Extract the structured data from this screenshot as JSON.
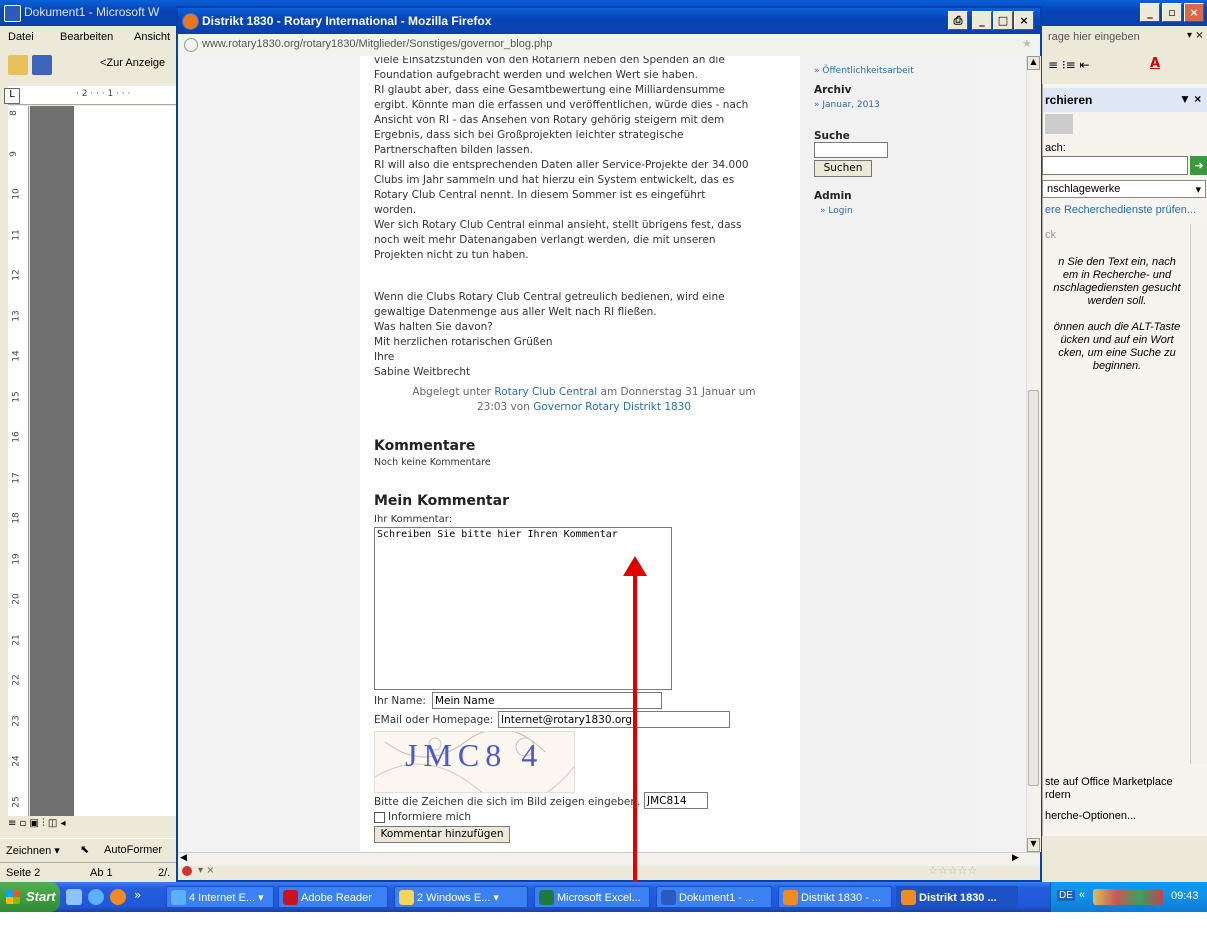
{
  "word": {
    "title": "Dokument1 - Microsoft W",
    "menu": [
      "Datei",
      "Bearbeiten",
      "Ansicht"
    ],
    "toolbar_dropdown": "<Zur Anzeige",
    "help_placeholder": "rage hier eingeben",
    "taskpane_title": "rchieren",
    "taskpane_search_label": "ach:",
    "taskpane_select": "nschlagewerke",
    "taskpane_link": "ere Recherchedienste prüfen...",
    "taskpane_back": "ck",
    "taskpane_help": [
      "n Sie den Text ein, nach",
      "em in Recherche- und",
      "nschlagediensten gesucht",
      "werden soll.",
      "",
      "önnen auch die ALT-Taste",
      "ücken und auf ein Wort",
      "cken, um eine Suche zu",
      "beginnen."
    ],
    "taskpane_bottom1": [
      "ste auf Office Marketplace",
      "rdern"
    ],
    "taskpane_bottom2": "herche-Optionen...",
    "drawing_toolbar": [
      "Zeichnen ▾",
      "AutoFormer"
    ],
    "status": [
      "Seite 2",
      "Ab 1",
      "2/."
    ],
    "ruler_marks": [
      "8",
      "9",
      "10",
      "11",
      "12",
      "13",
      "14",
      "15",
      "16",
      "17",
      "18",
      "19",
      "20",
      "21",
      "22",
      "23",
      "24",
      "25"
    ],
    "horiz_ruler": "· 2 · · · 1 · · ·"
  },
  "firefox": {
    "title": "Distrikt 1830 - Rotary International - Mozilla Firefox",
    "url": "www.rotary1830.org/rotary1830/Mitglieder/Sonstiges/governor_blog.php"
  },
  "post": {
    "lines": [
      "viele Einsatzstunden von den Rotariern neben den Spenden an die",
      "Foundation aufgebracht werden und welchen Wert sie haben.",
      "RI glaubt aber, dass eine Gesamtbewertung eine Milliardensumme",
      "ergibt. Könnte man die erfassen und veröffentlichen, würde dies - nach",
      "Ansicht von RI - das Ansehen von Rotary gehörig steigern mit dem",
      "Ergebnis, dass sich bei Großprojekten leichter strategische",
      "Partnerschaften bilden lassen.",
      "RI will also die entsprechenden Daten aller Service-Projekte der 34.000",
      "Clubs im Jahr sammeln und hat hierzu ein System entwickelt, das es",
      "Rotary Club Central nennt. In diesem Sommer ist es eingeführt",
      "worden.",
      "Wer sich Rotary Club Central einmal ansieht, stellt übrigens fest, dass",
      "noch weit mehr Datenangaben verlangt werden, die mit unseren",
      "Projekten nicht zu tun haben."
    ],
    "para2": [
      "Wenn die Clubs Rotary Club Central getreulich bedienen, wird eine",
      "gewaltige Datenmenge aus aller Welt nach RI fließen.",
      "Was halten Sie davon?"
    ],
    "closing": [
      "Mit herzlichen rotarischen Grüßen",
      "Ihre",
      "Sabine Weitbrecht"
    ],
    "meta_prefix": "Abgelegt unter",
    "meta_category": "Rotary Club Central",
    "meta_mid": "am Donnerstag 31 Januar um",
    "meta_time": "23:03 von",
    "meta_author": "Governor Rotary Distrikt 1830"
  },
  "comments": {
    "heading": "Kommentare",
    "none": "Noch keine Kommentare"
  },
  "form": {
    "heading": "Mein Kommentar",
    "comment_label": "Ihr Kommentar:",
    "comment_value": "Schreiben Sie bitte hier Ihren Kommentar",
    "name_label": "Ihr Name:",
    "name_value": "Mein Name",
    "email_label": "EMail oder Homepage:",
    "email_value": "Internet@rotary1830.org",
    "captcha_text": "JMC8 4",
    "captcha_label": "Bitte die Zeichen die sich im Bild zeigen eingeben.",
    "captcha_value": "JMC814",
    "notify_label": "Informiere mich",
    "submit_label": "Kommentar hinzufügen"
  },
  "sidebar": {
    "top_link": "» Öffentlichkeitsarbeit",
    "archive_heading": "Archiv",
    "archive_link": "» Januar, 2013",
    "search_heading": "Suche",
    "search_button": "Suchen",
    "admin_heading": "Admin",
    "admin_link": "» Login"
  },
  "taskbar": {
    "start": "Start",
    "items": [
      "4 Internet E... ▾",
      "Adobe Reader",
      "2 Windows E... ▾",
      "Microsoft Excel...",
      "Dokument1 - ...",
      "Distrikt 1830 - ...",
      "Distrikt 1830 ..."
    ],
    "tray_lang": "DE",
    "clock": "09:43"
  },
  "colors": {
    "link": "#2570a8",
    "xp_blue": "#0841ad",
    "annotation": "#e00000"
  }
}
